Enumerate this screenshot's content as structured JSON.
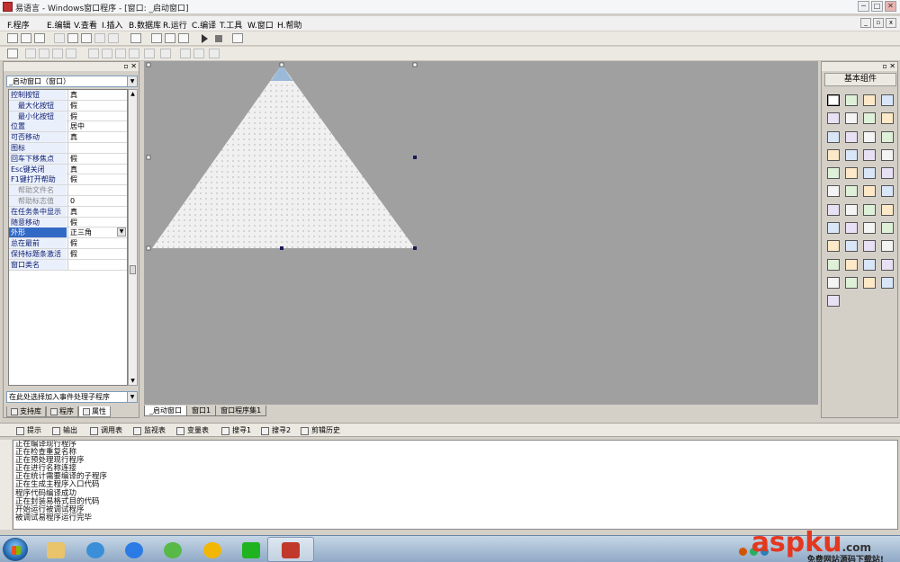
{
  "window": {
    "title": "易语言 - Windows窗口程序 - [窗口: _启动窗口]",
    "controls": [
      "─",
      "□",
      "✕"
    ]
  },
  "menu": {
    "items": [
      "F.程序",
      "E.编辑",
      "V.查看",
      "I.插入",
      "B.数据库",
      "R.运行",
      "C.编译",
      "T.工具",
      "W.窗口",
      "H.帮助"
    ],
    "mdi_controls": [
      "_",
      "▫",
      "x"
    ]
  },
  "left_panel": {
    "object_selector": "_启动窗口（窗口）",
    "properties": [
      {
        "name": "控制按钮",
        "value": "真",
        "sub": false
      },
      {
        "name": "最大化按钮",
        "value": "假",
        "sub": true
      },
      {
        "name": "最小化按钮",
        "value": "假",
        "sub": true
      },
      {
        "name": "位置",
        "value": "居中",
        "sub": false
      },
      {
        "name": "可否移动",
        "value": "真",
        "sub": false
      },
      {
        "name": "图标",
        "value": "",
        "sub": false
      },
      {
        "name": "回车下移焦点",
        "value": "假",
        "sub": false
      },
      {
        "name": "Esc键关闭",
        "value": "真",
        "sub": false
      },
      {
        "name": "F1键打开帮助",
        "value": "假",
        "sub": false
      },
      {
        "name": "帮助文件名",
        "value": "",
        "sub": true,
        "gray": true
      },
      {
        "name": "帮助标志值",
        "value": "0",
        "sub": true,
        "gray": true
      },
      {
        "name": "在任务条中显示",
        "value": "真",
        "sub": false
      },
      {
        "name": "随意移动",
        "value": "假",
        "sub": false
      },
      {
        "name": "外形",
        "value": "正三角",
        "sub": false,
        "selected": true
      },
      {
        "name": "总在最前",
        "value": "假",
        "sub": false
      },
      {
        "name": "保持标题条激活",
        "value": "假",
        "sub": false
      },
      {
        "name": "窗口类名",
        "value": "",
        "sub": false
      }
    ],
    "event_selector": "在此处选择加入事件处理子程序",
    "tabs": [
      "支持库",
      "程序",
      "属性"
    ]
  },
  "design": {
    "tabs": [
      "_启动窗口",
      "窗口1",
      "窗口程序集1"
    ]
  },
  "right_panel": {
    "title": "基本组件",
    "component_count": 45
  },
  "output": {
    "tabs": [
      "提示",
      "输出",
      "调用表",
      "监视表",
      "变量表",
      "搜寻1",
      "搜寻2",
      "剪辑历史"
    ],
    "lines": [
      "正在编译现行程序",
      "正在检查重复名称",
      "正在预处理现行程序",
      "正在进行名称连接",
      "正在统计需要编译的子程序",
      "正在生成主程序入口代码",
      "程序代码编译成功",
      "正在封装易格式目的代码",
      "开始运行被调试程序",
      "被调试易程序运行完毕"
    ]
  },
  "taskbar": {
    "watermark": "aspku",
    "watermark_tld": ".com",
    "watermark_caption": "免费网站源码下载站!"
  },
  "colors": {
    "design_bg": "#a0a0a0",
    "selection": "#316ac5",
    "watermark": "#e4371f"
  }
}
